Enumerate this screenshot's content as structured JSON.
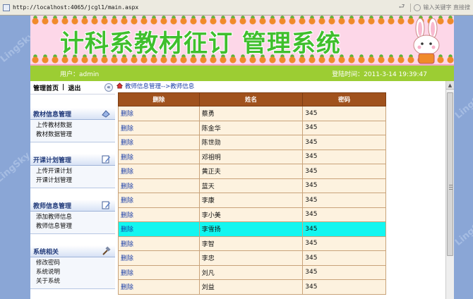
{
  "browser": {
    "url": "http://localhost:4065/jcgl1/main.aspx",
    "search_placeholder": "输入关键字 直接搜"
  },
  "watermark": "LingSky",
  "banner": {
    "title": "计科系教材征订  管理系统"
  },
  "userbar": {
    "user": "用户：admin",
    "login_time": "登陆时间：2011-3-14 19:39:47"
  },
  "sidebar": {
    "home": "管理首页",
    "separator": "|",
    "logout": "退出",
    "collapse_glyph": "«",
    "groups": [
      {
        "title": "教材信息管理",
        "items": [
          "上传教材数据",
          "教材数据管理"
        ]
      },
      {
        "title": "开课计划管理",
        "items": [
          "上传开课计划",
          "开课计划管理"
        ]
      },
      {
        "title": "教师信息管理",
        "items": [
          "添加教师信息",
          "教师信息管理"
        ]
      },
      {
        "title": "系统相关",
        "items": [
          "修改密码",
          "系统说明",
          "关于系统"
        ]
      }
    ]
  },
  "breadcrumb": "教师信息管理-->教师信息",
  "table": {
    "headers": [
      "删除",
      "姓名",
      "密码"
    ],
    "rows": [
      {
        "del": "删除",
        "name": "蔡勇",
        "pwd": "345"
      },
      {
        "del": "删除",
        "name": "陈金华",
        "pwd": "345"
      },
      {
        "del": "删除",
        "name": "陈世勋",
        "pwd": "345"
      },
      {
        "del": "删除",
        "name": "邓祖明",
        "pwd": "345"
      },
      {
        "del": "删除",
        "name": "黄正夫",
        "pwd": "345"
      },
      {
        "del": "删除",
        "name": "蓝天",
        "pwd": "345"
      },
      {
        "del": "删除",
        "name": "李康",
        "pwd": "345"
      },
      {
        "del": "删除",
        "name": "李小美",
        "pwd": "345"
      },
      {
        "del": "删除",
        "name": "李雪扬",
        "pwd": "345",
        "highlight": true
      },
      {
        "del": "删除",
        "name": "李智",
        "pwd": "345"
      },
      {
        "del": "删除",
        "name": "李忠",
        "pwd": "345"
      },
      {
        "del": "删除",
        "name": "刘凡",
        "pwd": "345"
      },
      {
        "del": "删除",
        "name": "刘益",
        "pwd": "345"
      }
    ]
  },
  "colors": {
    "header_bg": "#a0521d",
    "row_bg": "#fdf2df",
    "highlight_row": "#13f6f0",
    "userbar": "#9ccd33",
    "banner_title": "#3fbf2d"
  }
}
